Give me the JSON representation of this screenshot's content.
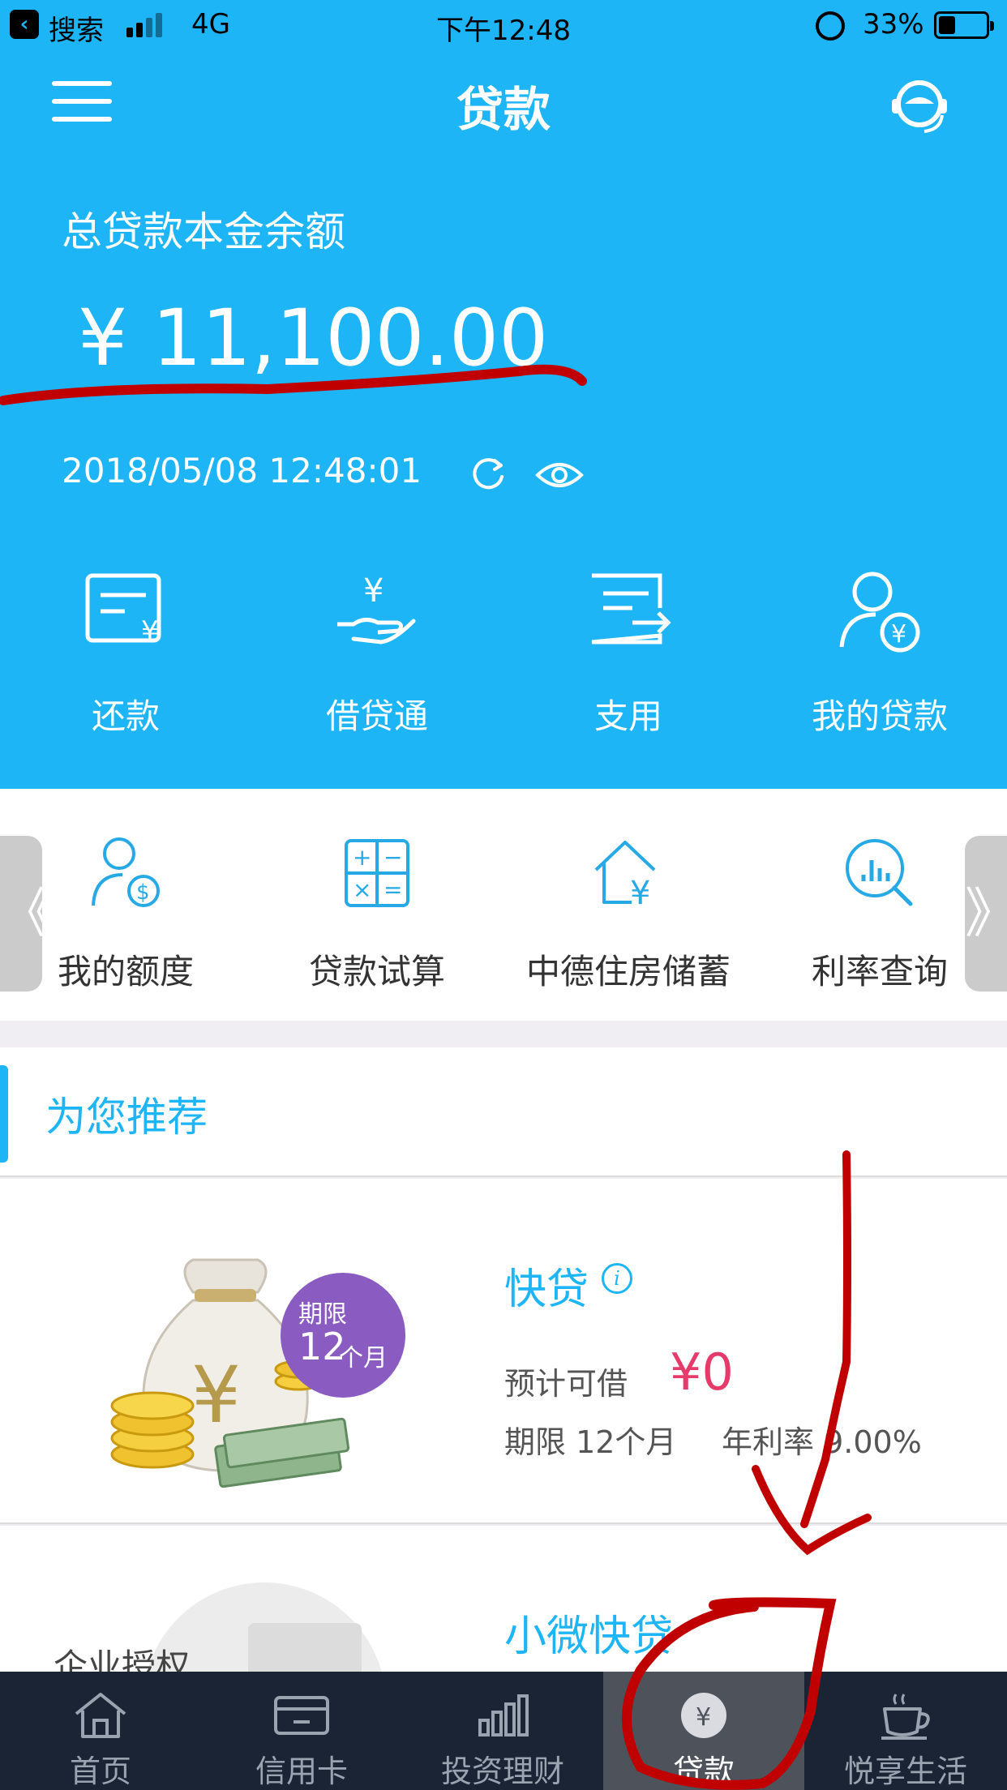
{
  "status_bar": {
    "carrier": "搜索",
    "network": "4G",
    "time": "下午12:48",
    "battery": "33%"
  },
  "header": {
    "title": "贷款",
    "balance_label": "总贷款本金余额",
    "balance_amount": "¥ 11,100.00",
    "timestamp": "2018/05/08 12:48:01"
  },
  "quick_actions": [
    {
      "label": "还款",
      "icon": "repay-bill-icon"
    },
    {
      "label": "借贷通",
      "icon": "yen-hand-icon"
    },
    {
      "label": "支用",
      "icon": "withdraw-doc-icon"
    },
    {
      "label": "我的贷款",
      "icon": "user-yen-icon"
    }
  ],
  "shortcuts": {
    "prev_arrow": "《",
    "next_arrow": "》",
    "items": [
      {
        "label": "我的额度",
        "icon": "user-dollar-icon"
      },
      {
        "label": "贷款试算",
        "icon": "calculator-icon"
      },
      {
        "label": "中德住房储蓄",
        "icon": "house-yen-icon"
      },
      {
        "label": "利率查询",
        "icon": "chart-search-icon"
      }
    ]
  },
  "recommend": {
    "title": "为您推荐",
    "products": [
      {
        "name": "快贷",
        "info_glyph": "i",
        "badge_line1": "期限",
        "badge_num": "12",
        "badge_unit": "个月",
        "estimate_label": "预计可借",
        "estimate_value": "¥0",
        "term": "期限  12个月",
        "rate": "年利率  9.00%"
      },
      {
        "name": "小微快贷",
        "image_label": "企业授权"
      }
    ]
  },
  "tab_bar": [
    {
      "label": "首页",
      "icon": "home-icon",
      "active": false
    },
    {
      "label": "信用卡",
      "icon": "credit-card-icon",
      "active": false
    },
    {
      "label": "投资理财",
      "icon": "bar-chart-icon",
      "active": false
    },
    {
      "label": "贷款",
      "icon": "yen-coin-icon",
      "active": true
    },
    {
      "label": "悦享生活",
      "icon": "coffee-cup-icon",
      "active": false
    }
  ],
  "colors": {
    "header_blue": "#1eb5f6",
    "amount_pink": "#e63a6a",
    "badge_purple": "#8a5cc1",
    "tab_bar_bg": "#1a2435",
    "marker_red": "#c00000"
  }
}
